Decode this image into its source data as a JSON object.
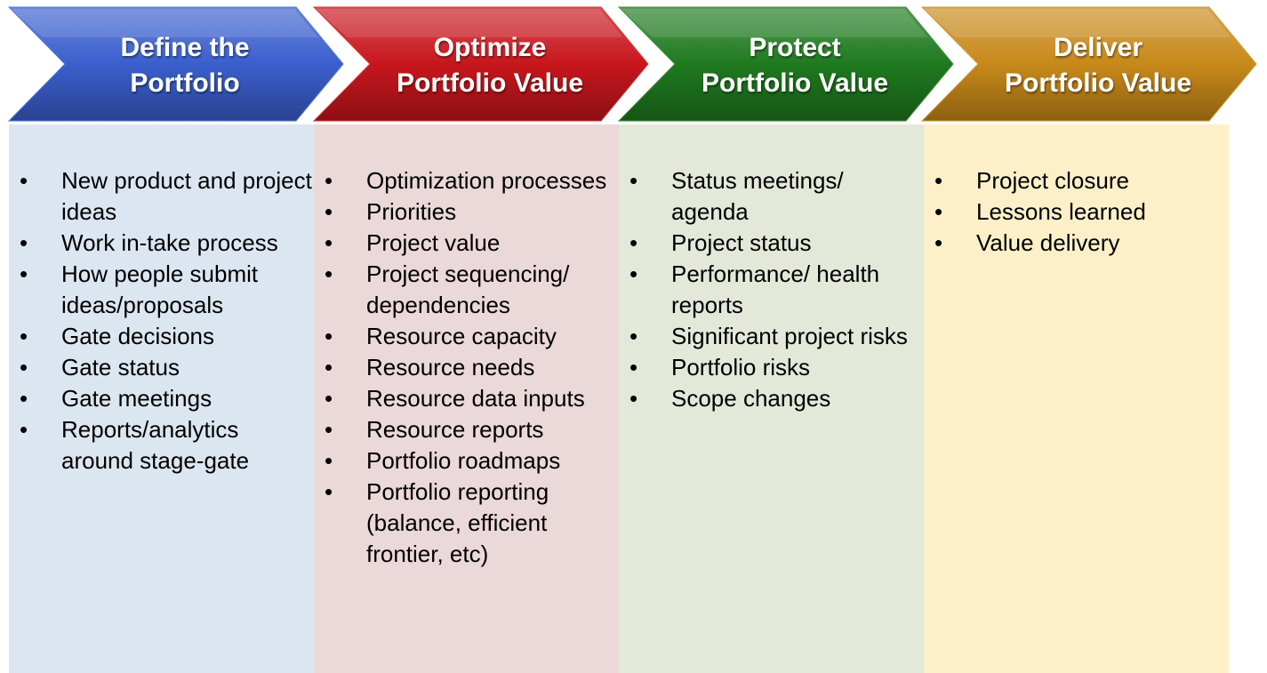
{
  "stages": [
    {
      "title_line1": "Define the",
      "title_line2": "Portfolio",
      "color": "#3a5fcd",
      "items": [
        "New product and project ideas",
        "Work in-take process",
        "How people submit ideas/proposals",
        "Gate decisions",
        "Gate status",
        "Gate meetings",
        "Reports/analytics around stage-gate"
      ]
    },
    {
      "title_line1": "Optimize",
      "title_line2": "Portfolio Value",
      "color": "#c8161d",
      "items": [
        "Optimization processes",
        "Priorities",
        "Project value",
        "Project sequencing/ dependencies",
        "Resource capacity",
        "Resource needs",
        "Resource data inputs",
        "Resource reports",
        "Portfolio roadmaps",
        "Portfolio reporting (balance, efficient frontier, etc)"
      ]
    },
    {
      "title_line1": "Protect",
      "title_line2": "Portfolio Value",
      "color": "#1f7a1f",
      "items": [
        "Status meetings/ agenda",
        "Project status",
        "Performance/ health reports",
        "Significant project risks",
        "Portfolio risks",
        "Scope changes"
      ]
    },
    {
      "title_line1": "Deliver",
      "title_line2": "Portfolio Value",
      "color": "#c8891a",
      "items": [
        "Project closure",
        "Lessons learned",
        "Value delivery"
      ]
    }
  ]
}
